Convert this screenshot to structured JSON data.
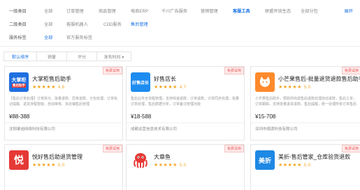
{
  "filters": {
    "row1": {
      "label": "一级类目",
      "options": [
        "全部",
        "订单管理",
        "商品管理",
        "电商ERP",
        "千川广告服务",
        "营销管理",
        "客服工具",
        "联盟开放生态",
        "全部分包"
      ],
      "active": "客服工具",
      "expand": "展开"
    },
    "row2": {
      "label": "二级类目",
      "options": [
        "全部",
        "客服机器人",
        "CDD服务",
        "售后管理"
      ],
      "active": "售后管理"
    },
    "row3": {
      "label": "服务标签",
      "options": [
        "全部",
        "官方服务标签"
      ],
      "active": "全部"
    }
  },
  "sort": {
    "options": [
      "默认排序",
      "销量",
      "评分",
      "发布时间 ▾"
    ],
    "active": "默认排序"
  },
  "cards": [
    {
      "title": "大掌柜售后助手",
      "badge": "免费试用",
      "logo_text": "大掌柜",
      "logo_sub": "售后助手",
      "rating": "4.6",
      "desc": "【售后订单处理】订单拆分、批量退款、异常退款、分包处理、订单标记提醒、退货流程智能、自动审核、多店铺售后管理",
      "price": "¥88-388",
      "company": "沈阳聚迪网络科技有限公司"
    },
    {
      "title": "好售店长",
      "badge": "免费试用",
      "logo_text": "好售店长",
      "rating": "4.7",
      "desc": "售后业务全流程管理，支持快速退款，订单退款，订单同步处理，批量订单处理，售后数据分析，订单备注管理功能",
      "price": "¥18-588",
      "company": "成都运营信息技术有限公司"
    },
    {
      "title": "小芒果售后-批量退货退款售后助手",
      "badge": "免费试用",
      "logo_text": "",
      "rating": "5.0",
      "desc": "小芒果售后助手，帮助你完成售后退款处理自动退款，售后工单，订单跟踪，支持批量退货退款，售后提醒，统一处理所有订单售后",
      "price": "¥15-708",
      "company": "深圳市德源科技有限公司"
    },
    {
      "title": "悦好售后助退货管理",
      "badge": "免费试用",
      "logo_text": "悦",
      "rating": "5.0",
      "desc": "",
      "price": "",
      "company": ""
    },
    {
      "title": "大章鱼",
      "badge": "免费试用",
      "logo_text": "",
      "rating": "5.0",
      "desc": "",
      "price": "",
      "company": ""
    },
    {
      "title": "美折-售后管家_仓库验货退款",
      "badge": "免费试用",
      "logo_text": "美折",
      "rating": "5.0",
      "desc": "",
      "price": "",
      "company": ""
    }
  ],
  "colors": {
    "accent": "#1a73e8",
    "star": "#f5a623",
    "badge": "#f25757"
  }
}
